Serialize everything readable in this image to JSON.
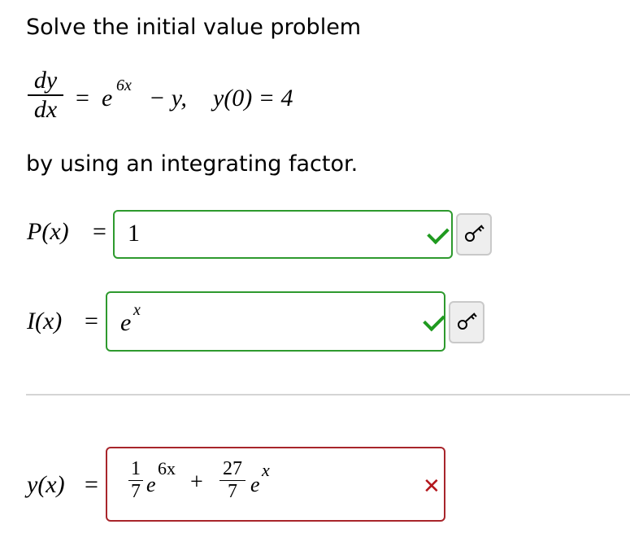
{
  "prompt": {
    "intro": "Solve the initial value problem",
    "method": "by using an integrating factor."
  },
  "ode": {
    "numerator": "dy",
    "denominator": "dx",
    "equals": "=",
    "base": "e",
    "exponent": "6x",
    "rest": "− y,",
    "ic": "y(0) = 4"
  },
  "fields": [
    {
      "label": "P(x)",
      "equals": "=",
      "value": "1",
      "status": "correct"
    },
    {
      "label": "I(x)",
      "equals": "=",
      "value_base": "e",
      "value_exp": "x",
      "status": "correct"
    },
    {
      "label": "y(x)",
      "equals": "=",
      "status": "incorrect",
      "term1": {
        "num": "1",
        "den": "7",
        "base": "e",
        "exp": "6x"
      },
      "plus": "+",
      "term2": {
        "num": "27",
        "den": "7",
        "base": "e",
        "exp": "x"
      }
    }
  ],
  "colors": {
    "correct": "#2e9a2e",
    "incorrect": "#a8252b",
    "key_button": "#eeeeee"
  },
  "icons": {
    "correct": "check-icon",
    "incorrect": "x-icon",
    "key": "key-icon"
  }
}
